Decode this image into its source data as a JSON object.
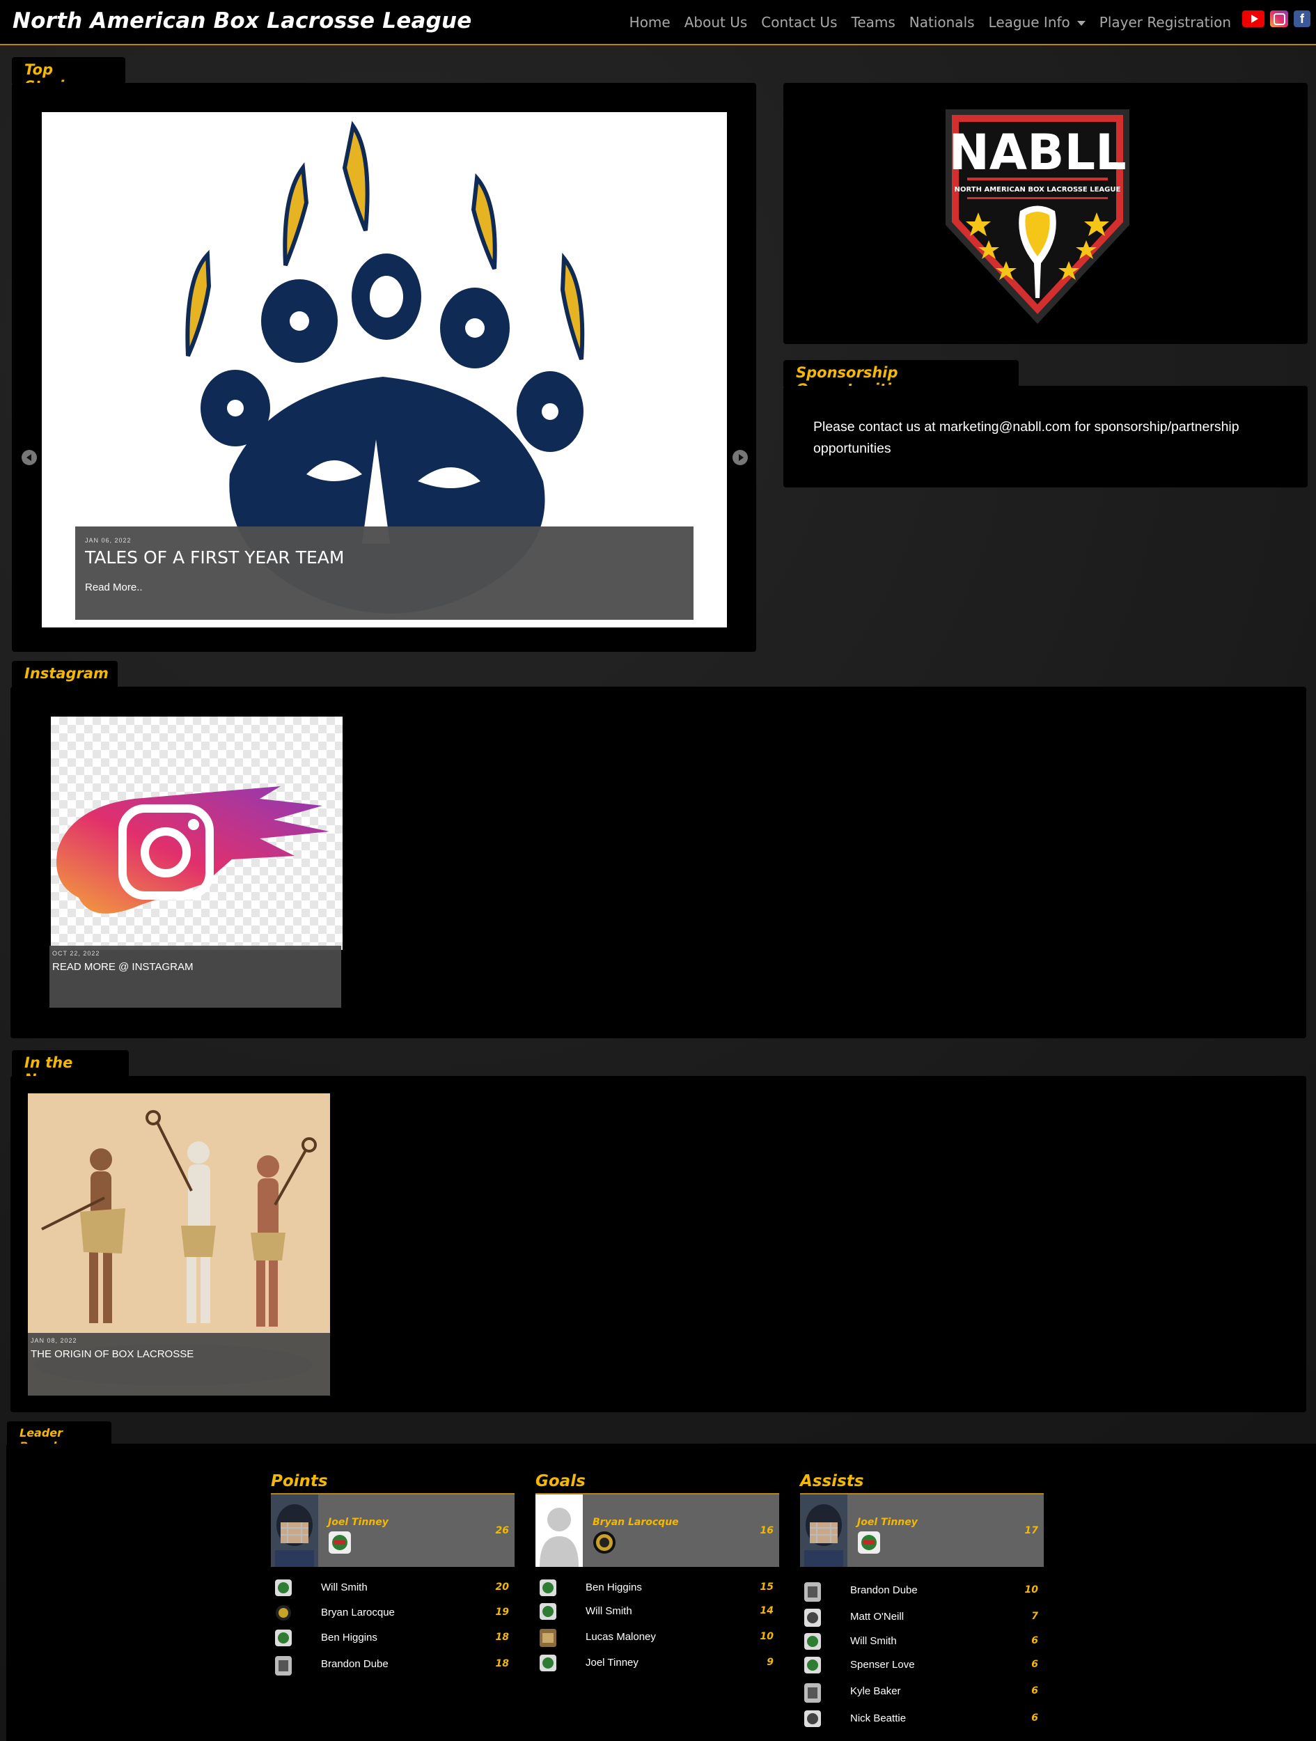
{
  "header": {
    "brand": "North American Box Lacrosse League",
    "nav": [
      "Home",
      "About Us",
      "Contact Us",
      "Teams",
      "Nationals",
      "League Info",
      "Player Registration"
    ],
    "social_icons": [
      "youtube-icon",
      "instagram-icon",
      "facebook-icon"
    ],
    "facebook_glyph": "f"
  },
  "top_stories": {
    "tab": "Top Stories",
    "slide": {
      "date": "JAN 06, 2022",
      "title": "TALES OF A FIRST YEAR TEAM",
      "more": "Read More.."
    }
  },
  "logo": {
    "text": "NABLL",
    "subtitle": "NORTH AMERICAN BOX LACROSSE LEAGUE"
  },
  "sponsorship": {
    "tab": "Sponsorship Opportunities",
    "text": "Please contact us at marketing@nabll.com for sponsorship/partnership opportunities"
  },
  "instagram": {
    "tab": "Instagram",
    "card": {
      "date": "OCT 22, 2022",
      "title": "READ MORE @ INSTAGRAM"
    }
  },
  "news": {
    "tab": "In the News",
    "card": {
      "date": "JAN 08, 2022",
      "title": "THE ORIGIN OF BOX LACROSSE"
    }
  },
  "leaderboard": {
    "tab": "Leader Board",
    "columns": [
      {
        "heading": "Points",
        "top": {
          "name": "Joel Tinney",
          "value": "26"
        },
        "rows": [
          {
            "name": "Will Smith",
            "value": "20"
          },
          {
            "name": "Bryan Larocque",
            "value": "19"
          },
          {
            "name": "Ben Higgins",
            "value": "18"
          },
          {
            "name": "Brandon Dube",
            "value": "18"
          }
        ]
      },
      {
        "heading": "Goals",
        "top": {
          "name": "Bryan Larocque",
          "value": "16"
        },
        "rows": [
          {
            "name": "Ben Higgins",
            "value": "15"
          },
          {
            "name": "Will Smith",
            "value": "14"
          },
          {
            "name": "Lucas Maloney",
            "value": "10"
          },
          {
            "name": "Joel Tinney",
            "value": "9"
          }
        ]
      },
      {
        "heading": "Assists",
        "top": {
          "name": "Joel Tinney",
          "value": "17"
        },
        "rows": [
          {
            "name": "Brandon Dube",
            "value": "10"
          },
          {
            "name": "Matt O'Neill",
            "value": "7"
          },
          {
            "name": "Will Smith",
            "value": "6"
          },
          {
            "name": "Spenser Love",
            "value": "6"
          },
          {
            "name": "Kyle Baker",
            "value": "6"
          },
          {
            "name": "Nick Beattie",
            "value": "6"
          }
        ]
      }
    ]
  }
}
